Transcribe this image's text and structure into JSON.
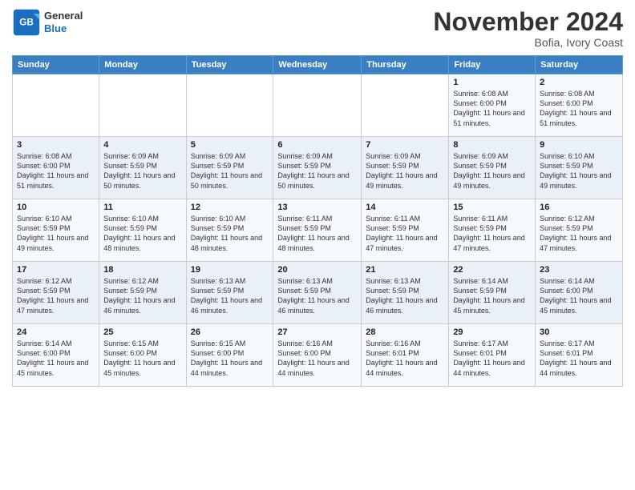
{
  "header": {
    "logo_line1": "General",
    "logo_line2": "Blue",
    "month_title": "November 2024",
    "location": "Bofia, Ivory Coast"
  },
  "weekdays": [
    "Sunday",
    "Monday",
    "Tuesday",
    "Wednesday",
    "Thursday",
    "Friday",
    "Saturday"
  ],
  "weeks": [
    [
      {
        "day": "",
        "info": ""
      },
      {
        "day": "",
        "info": ""
      },
      {
        "day": "",
        "info": ""
      },
      {
        "day": "",
        "info": ""
      },
      {
        "day": "",
        "info": ""
      },
      {
        "day": "1",
        "info": "Sunrise: 6:08 AM\nSunset: 6:00 PM\nDaylight: 11 hours and 51 minutes."
      },
      {
        "day": "2",
        "info": "Sunrise: 6:08 AM\nSunset: 6:00 PM\nDaylight: 11 hours and 51 minutes."
      }
    ],
    [
      {
        "day": "3",
        "info": "Sunrise: 6:08 AM\nSunset: 6:00 PM\nDaylight: 11 hours and 51 minutes."
      },
      {
        "day": "4",
        "info": "Sunrise: 6:09 AM\nSunset: 5:59 PM\nDaylight: 11 hours and 50 minutes."
      },
      {
        "day": "5",
        "info": "Sunrise: 6:09 AM\nSunset: 5:59 PM\nDaylight: 11 hours and 50 minutes."
      },
      {
        "day": "6",
        "info": "Sunrise: 6:09 AM\nSunset: 5:59 PM\nDaylight: 11 hours and 50 minutes."
      },
      {
        "day": "7",
        "info": "Sunrise: 6:09 AM\nSunset: 5:59 PM\nDaylight: 11 hours and 49 minutes."
      },
      {
        "day": "8",
        "info": "Sunrise: 6:09 AM\nSunset: 5:59 PM\nDaylight: 11 hours and 49 minutes."
      },
      {
        "day": "9",
        "info": "Sunrise: 6:10 AM\nSunset: 5:59 PM\nDaylight: 11 hours and 49 minutes."
      }
    ],
    [
      {
        "day": "10",
        "info": "Sunrise: 6:10 AM\nSunset: 5:59 PM\nDaylight: 11 hours and 49 minutes."
      },
      {
        "day": "11",
        "info": "Sunrise: 6:10 AM\nSunset: 5:59 PM\nDaylight: 11 hours and 48 minutes."
      },
      {
        "day": "12",
        "info": "Sunrise: 6:10 AM\nSunset: 5:59 PM\nDaylight: 11 hours and 48 minutes."
      },
      {
        "day": "13",
        "info": "Sunrise: 6:11 AM\nSunset: 5:59 PM\nDaylight: 11 hours and 48 minutes."
      },
      {
        "day": "14",
        "info": "Sunrise: 6:11 AM\nSunset: 5:59 PM\nDaylight: 11 hours and 47 minutes."
      },
      {
        "day": "15",
        "info": "Sunrise: 6:11 AM\nSunset: 5:59 PM\nDaylight: 11 hours and 47 minutes."
      },
      {
        "day": "16",
        "info": "Sunrise: 6:12 AM\nSunset: 5:59 PM\nDaylight: 11 hours and 47 minutes."
      }
    ],
    [
      {
        "day": "17",
        "info": "Sunrise: 6:12 AM\nSunset: 5:59 PM\nDaylight: 11 hours and 47 minutes."
      },
      {
        "day": "18",
        "info": "Sunrise: 6:12 AM\nSunset: 5:59 PM\nDaylight: 11 hours and 46 minutes."
      },
      {
        "day": "19",
        "info": "Sunrise: 6:13 AM\nSunset: 5:59 PM\nDaylight: 11 hours and 46 minutes."
      },
      {
        "day": "20",
        "info": "Sunrise: 6:13 AM\nSunset: 5:59 PM\nDaylight: 11 hours and 46 minutes."
      },
      {
        "day": "21",
        "info": "Sunrise: 6:13 AM\nSunset: 5:59 PM\nDaylight: 11 hours and 46 minutes."
      },
      {
        "day": "22",
        "info": "Sunrise: 6:14 AM\nSunset: 5:59 PM\nDaylight: 11 hours and 45 minutes."
      },
      {
        "day": "23",
        "info": "Sunrise: 6:14 AM\nSunset: 6:00 PM\nDaylight: 11 hours and 45 minutes."
      }
    ],
    [
      {
        "day": "24",
        "info": "Sunrise: 6:14 AM\nSunset: 6:00 PM\nDaylight: 11 hours and 45 minutes."
      },
      {
        "day": "25",
        "info": "Sunrise: 6:15 AM\nSunset: 6:00 PM\nDaylight: 11 hours and 45 minutes."
      },
      {
        "day": "26",
        "info": "Sunrise: 6:15 AM\nSunset: 6:00 PM\nDaylight: 11 hours and 44 minutes."
      },
      {
        "day": "27",
        "info": "Sunrise: 6:16 AM\nSunset: 6:00 PM\nDaylight: 11 hours and 44 minutes."
      },
      {
        "day": "28",
        "info": "Sunrise: 6:16 AM\nSunset: 6:01 PM\nDaylight: 11 hours and 44 minutes."
      },
      {
        "day": "29",
        "info": "Sunrise: 6:17 AM\nSunset: 6:01 PM\nDaylight: 11 hours and 44 minutes."
      },
      {
        "day": "30",
        "info": "Sunrise: 6:17 AM\nSunset: 6:01 PM\nDaylight: 11 hours and 44 minutes."
      }
    ]
  ]
}
